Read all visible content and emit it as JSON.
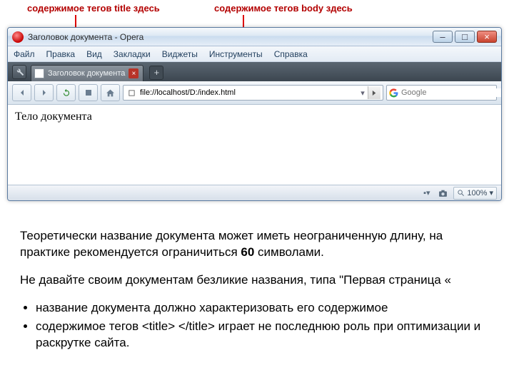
{
  "annotations": {
    "title_pointer": "содержимое тегов title здесь",
    "body_pointer": "содержимое тегов body здесь"
  },
  "window": {
    "title": "Заголовок документа - Opera",
    "controls": {
      "minimize": "–",
      "maximize": "□",
      "close": "×"
    }
  },
  "menu": {
    "file": "Файл",
    "edit": "Правка",
    "view": "Вид",
    "bookmarks": "Закладки",
    "widgets": "Виджеты",
    "tools": "Инструменты",
    "help": "Справка"
  },
  "tab": {
    "label": "Заголовок документа",
    "close": "×",
    "new": "+"
  },
  "toolbar": {
    "url": "file://localhost/D:/index.html",
    "search_placeholder": "Google"
  },
  "page": {
    "body_text": "Тело документа"
  },
  "status": {
    "zoom": "100%"
  },
  "article": {
    "p1_a": "Теоретически название документа может иметь неограниченную длину, на практике рекомендуется ограничиться ",
    "p1_b": "60",
    "p1_c": " символами.",
    "p2": "Не давайте своим документам безликие названия, типа \"Первая страница «",
    "li1": "название документа должно характеризовать его содержимое",
    "li2": "содержимое тегов <title> </title> играет не последнюю роль при оптимизации и раскрутке сайта."
  }
}
